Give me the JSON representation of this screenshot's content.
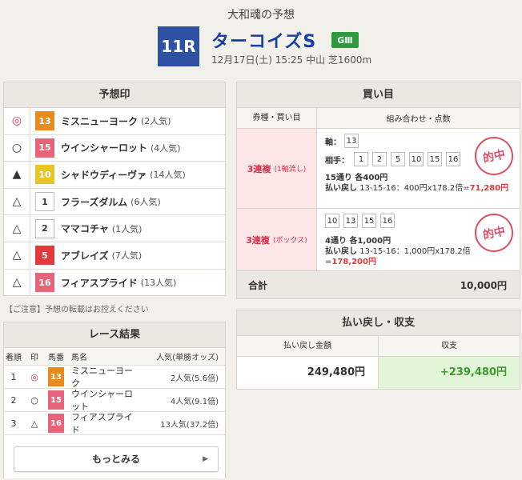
{
  "header": {
    "subtitle": "大和魂の予想",
    "race_no": "11R",
    "race_name": "ターコイズS",
    "grade": "GⅢ",
    "race_info": "12月17日(土) 15:25 中山 芝1600m"
  },
  "prediction": {
    "title": "予想印",
    "rows": [
      {
        "mark": "◎",
        "num": "13",
        "name": "ミスニューヨーク",
        "pop": "(2人気)"
      },
      {
        "mark": "○",
        "num": "15",
        "name": "ウインシャーロット",
        "pop": "(4人気)"
      },
      {
        "mark": "▲",
        "num": "10",
        "name": "シャドウディーヴァ",
        "pop": "(14人気)"
      },
      {
        "mark": "△",
        "num": "1",
        "name": "フラーズダルム",
        "pop": "(6人気)"
      },
      {
        "mark": "△",
        "num": "2",
        "name": "ママコチャ",
        "pop": "(1人気)"
      },
      {
        "mark": "△",
        "num": "5",
        "name": "アブレイズ",
        "pop": "(7人気)"
      },
      {
        "mark": "△",
        "num": "16",
        "name": "フィアスプライド",
        "pop": "(13人気)"
      }
    ]
  },
  "caution": "【ご注意】予想の転載はお控えください",
  "results": {
    "title": "レース結果",
    "headers": [
      "着順",
      "印",
      "馬番",
      "馬名",
      "人気(単勝オッズ)"
    ],
    "rows": [
      {
        "rank": "1",
        "mark": "◎",
        "num": "13",
        "name": "ミスニューヨーク",
        "pop": "2人気(5.6倍)"
      },
      {
        "rank": "2",
        "mark": "○",
        "num": "15",
        "name": "ウインシャーロット",
        "pop": "4人気(9.1倍)"
      },
      {
        "rank": "3",
        "mark": "△",
        "num": "16",
        "name": "フィアスプライド",
        "pop": "13人気(37.2倍)"
      }
    ],
    "more_label": "もっとみる"
  },
  "bets": {
    "title": "買い目",
    "header_type": "券種・買い目",
    "header_combo": "組み合わせ・点数",
    "stamp": "的中",
    "row1": {
      "type": "3連複",
      "sub": "(1軸流し)",
      "axis_label": "軸",
      "axis_colon": "：",
      "axis_nums": [
        "13"
      ],
      "partner_label": "相手：",
      "partner_nums": [
        "1",
        "2",
        "5",
        "10",
        "15",
        "16"
      ],
      "summary": "15通り 各400円",
      "payout_label": "払い戻し",
      "payout_text": "13-15-16：400円x178.2倍=",
      "payout_hit": "71,280円"
    },
    "row2": {
      "type": "3連複",
      "sub": "(ボックス)",
      "nums": [
        "10",
        "13",
        "15",
        "16"
      ],
      "summary": "4通り 各1,000円",
      "payout_label": "払い戻し",
      "payout_text": "13-15-16：1,000円x178.2倍=",
      "payout_hit": "178,200円"
    },
    "total_label": "合計",
    "total_value": "10,000円"
  },
  "payout_summary": {
    "title": "払い戻し・収支",
    "label_payout": "払い戻し金額",
    "label_profit": "収支",
    "payout": "249,480円",
    "profit": "+239,480円"
  }
}
